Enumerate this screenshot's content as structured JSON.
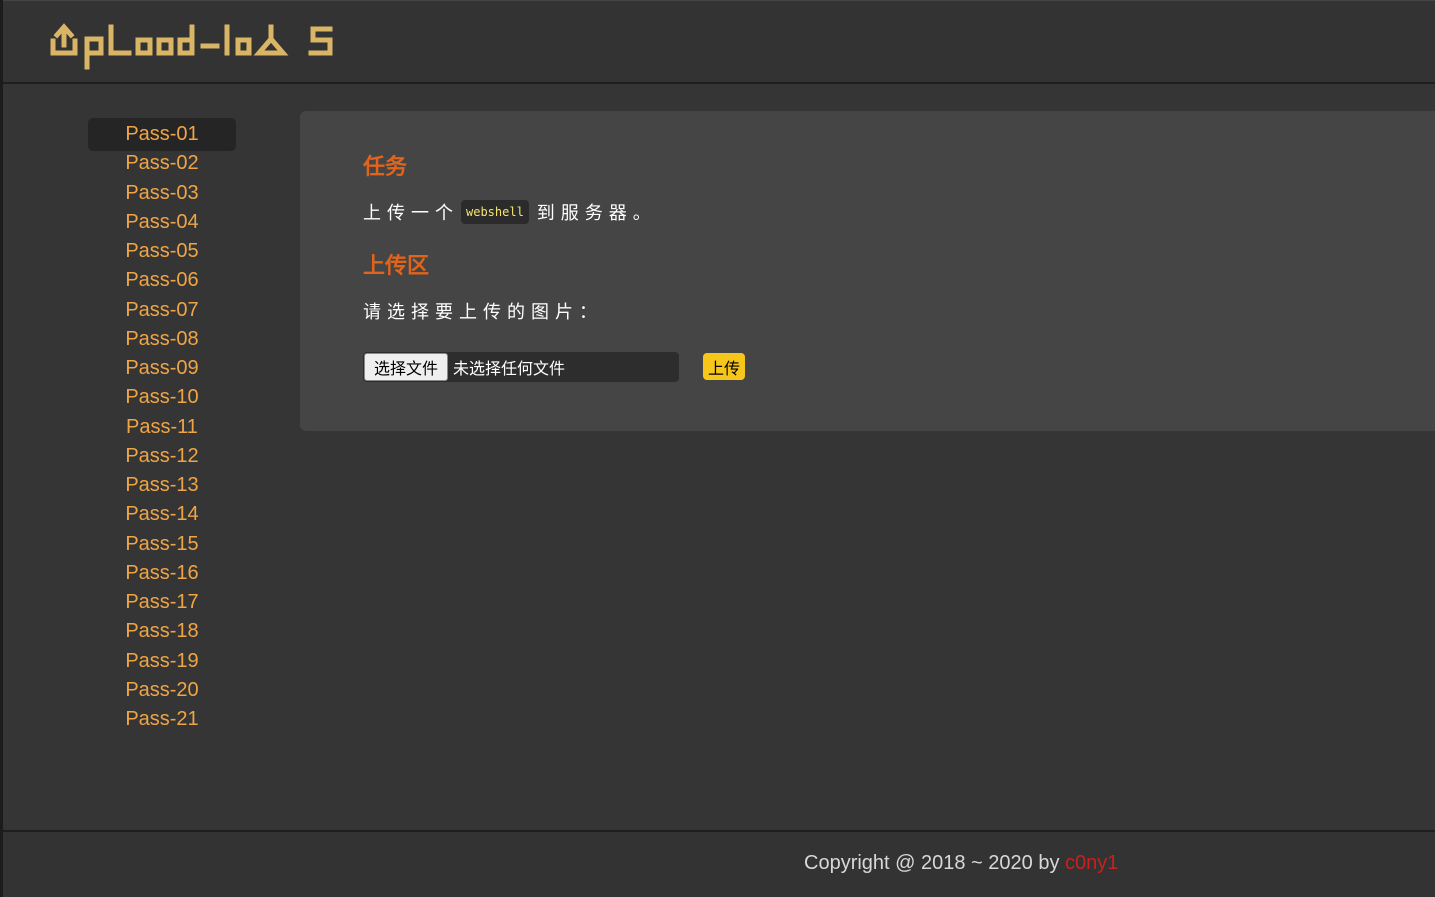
{
  "header": {
    "logo_text": "Upload-labs"
  },
  "sidebar": {
    "items": [
      {
        "label": "Pass-01",
        "active": true
      },
      {
        "label": "Pass-02"
      },
      {
        "label": "Pass-03"
      },
      {
        "label": "Pass-04"
      },
      {
        "label": "Pass-05"
      },
      {
        "label": "Pass-06"
      },
      {
        "label": "Pass-07"
      },
      {
        "label": "Pass-08"
      },
      {
        "label": "Pass-09"
      },
      {
        "label": "Pass-10"
      },
      {
        "label": "Pass-11"
      },
      {
        "label": "Pass-12"
      },
      {
        "label": "Pass-13"
      },
      {
        "label": "Pass-14"
      },
      {
        "label": "Pass-15"
      },
      {
        "label": "Pass-16"
      },
      {
        "label": "Pass-17"
      },
      {
        "label": "Pass-18"
      },
      {
        "label": "Pass-19"
      },
      {
        "label": "Pass-20"
      },
      {
        "label": "Pass-21"
      }
    ]
  },
  "main": {
    "task_heading": "任务",
    "task_text_before": "上传一个",
    "task_code": "webshell",
    "task_text_after": "到服务器。",
    "upload_heading": "上传区",
    "upload_prompt": "请选择要上传的图片：",
    "choose_file_label": "选择文件",
    "no_file_text": "未选择任何文件",
    "submit_label": "上传"
  },
  "footer": {
    "copyright_text": "Copyright @ 2018 ~ 2020 by ",
    "author": "c0ny1"
  },
  "colors": {
    "accent_orange": "#f0a545",
    "heading_orange": "#e0641c",
    "submit_yellow": "#f7c61a",
    "author_red": "#c8201e",
    "code_yellow": "#f6e56a"
  }
}
